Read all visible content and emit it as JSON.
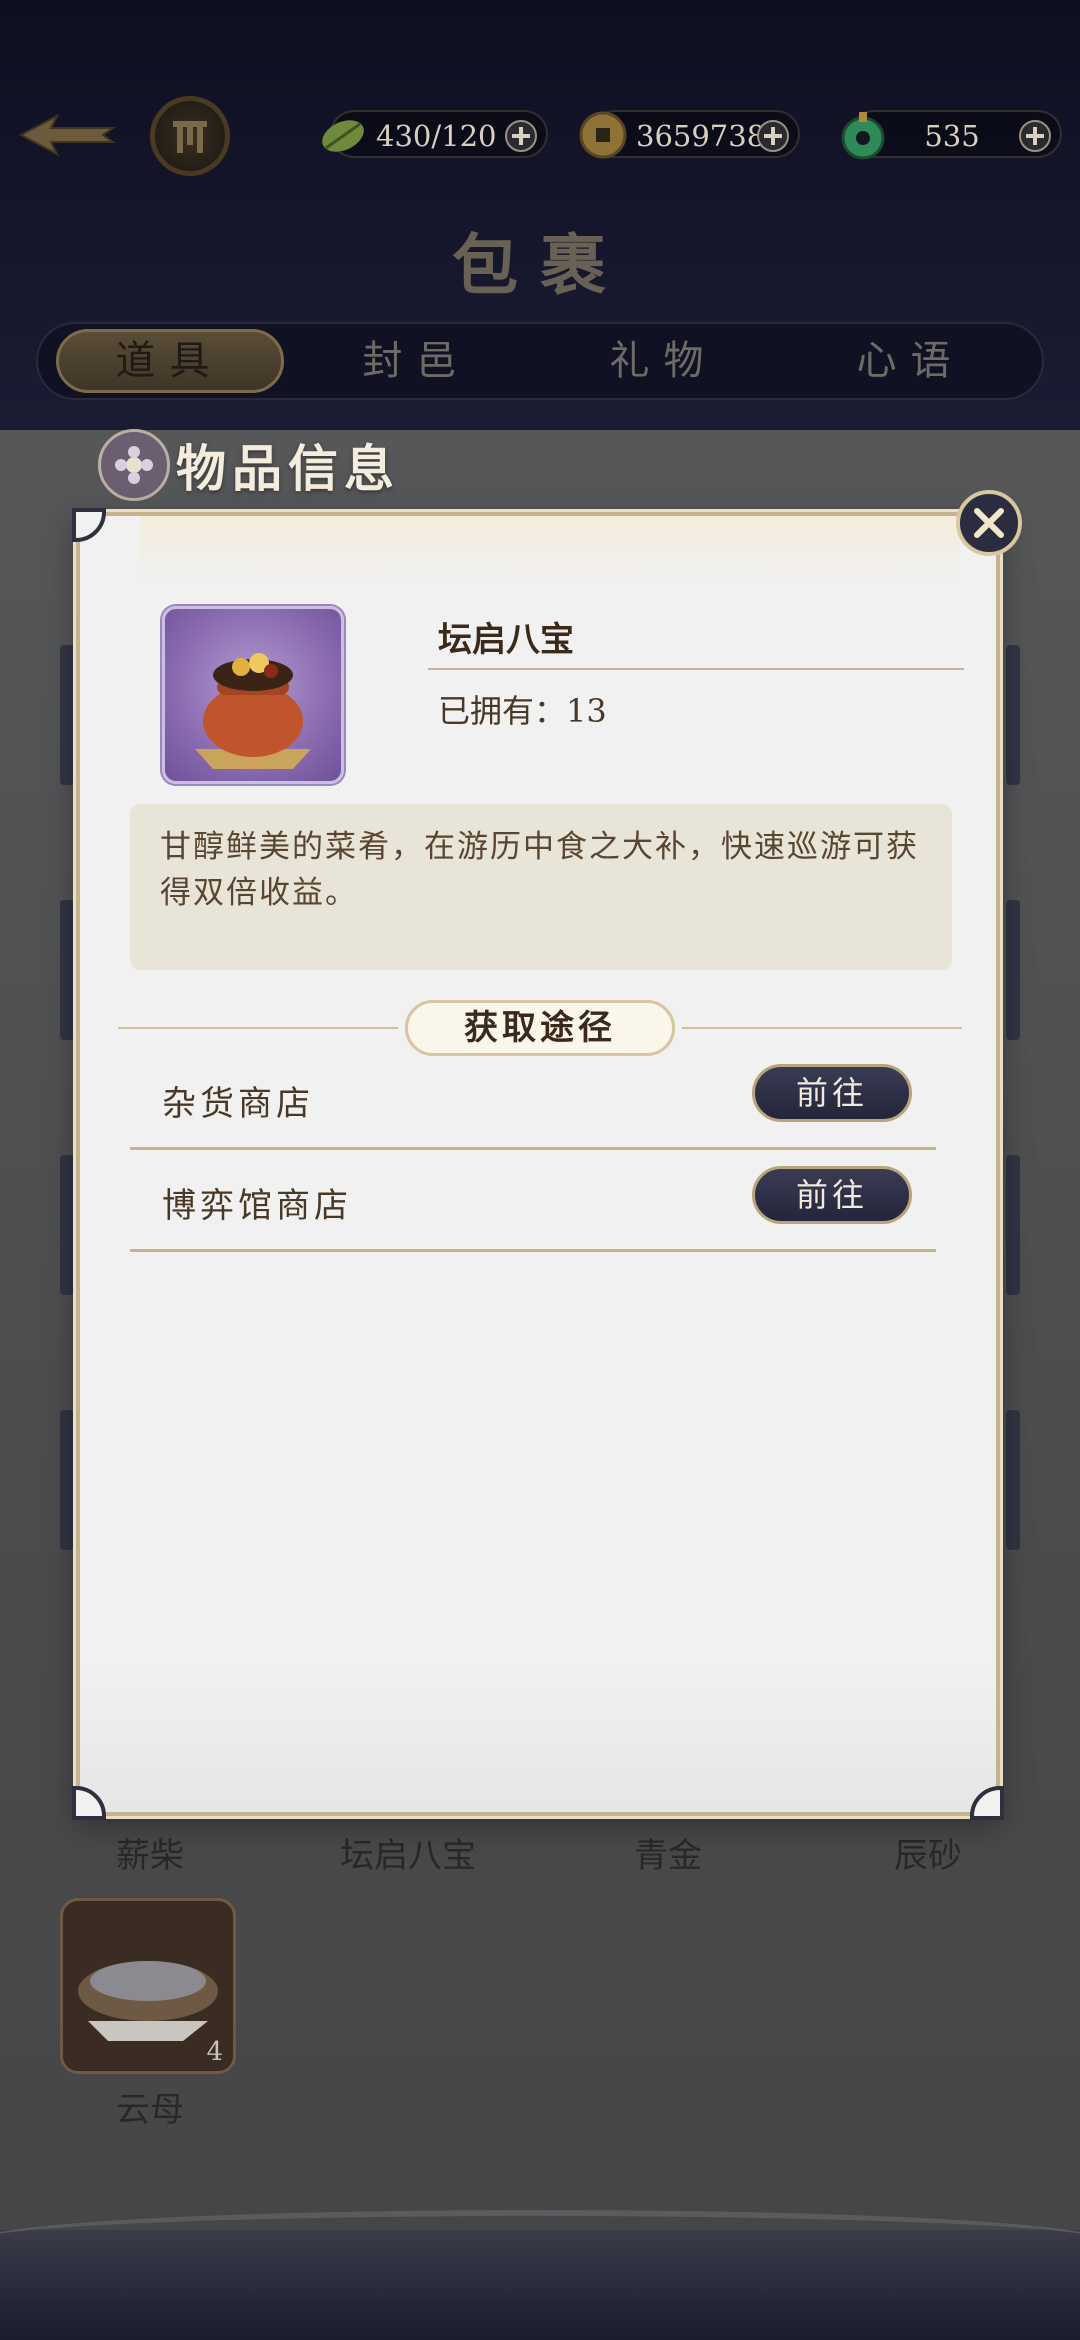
{
  "resources": {
    "stamina": "430/120",
    "coins": "3659738",
    "jade": "535"
  },
  "header": {
    "title": "包裹"
  },
  "tabs": [
    {
      "label": "道具",
      "active": true
    },
    {
      "label": "封邑",
      "active": false
    },
    {
      "label": "礼物",
      "active": false
    },
    {
      "label": "心语",
      "active": false
    }
  ],
  "section": {
    "label": "物品信息"
  },
  "background_items": {
    "row": [
      "薪柴",
      "坛启八宝",
      "青金",
      "辰砂"
    ],
    "tile_name": "云母",
    "tile_count": "4"
  },
  "item": {
    "name": "坛启八宝",
    "owned": "已拥有：13",
    "description": "甘醇鲜美的菜肴，在游历中食之大补，快速巡游可获得双倍收益。"
  },
  "sources": {
    "header": "获取途径",
    "list": [
      {
        "name": "杂货商店",
        "action": "前往"
      },
      {
        "name": "博弈馆商店",
        "action": "前往"
      }
    ]
  },
  "colors": {
    "accent_gold": "#c6b38d",
    "button_dark": "#2b2c3f",
    "panel_bg": "#f1f1f1"
  }
}
